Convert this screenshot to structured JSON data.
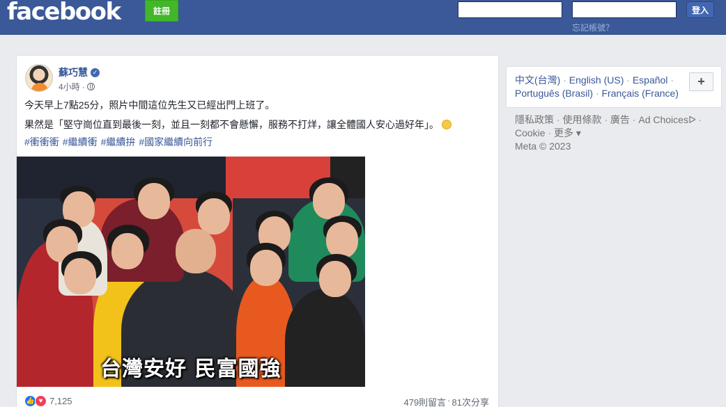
{
  "header": {
    "logo": "facebook",
    "signup_label": "註冊",
    "login_label": "登入",
    "forgot_label": "忘記帳號？"
  },
  "post": {
    "author": "蘇巧慧",
    "time": "4小時",
    "line1": "今天早上7點25分，照片中間這位先生又已經出門上班了。",
    "line2": "果然是「堅守崗位直到最後一刻，並且一刻都不會懸懈，服務不打烊，讓全體國人安心過好年」。",
    "hashtags": [
      "#衝衝衝",
      "#繼續衝",
      "#繼續拚",
      "#國家繼續向前行"
    ],
    "photo_caption": "台灣安好 民富國強",
    "reaction_count": "7,125",
    "comments": "479則留言",
    "shares": "81次分享"
  },
  "sidebar": {
    "languages": [
      "中文(台灣)",
      "English (US)",
      "Español",
      "Português (Brasil)",
      "Français (France)"
    ],
    "add_language": "+",
    "footer_links": [
      "隱私政策",
      "使用條款",
      "廣告",
      "Ad Choices",
      "Cookie",
      "更多"
    ],
    "copyright": "Meta © 2023"
  },
  "colors": {
    "brand_blue": "#3b5998",
    "signup_green": "#42b72a",
    "link_blue": "#385898"
  }
}
